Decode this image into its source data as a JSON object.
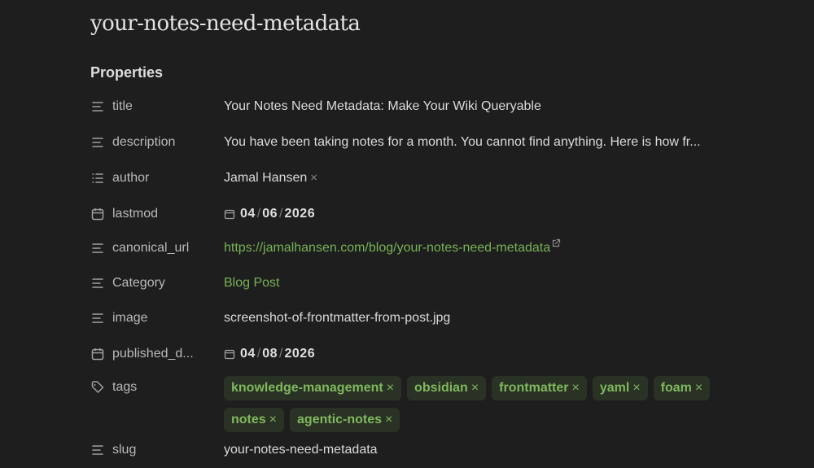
{
  "page": {
    "title": "your-notes-need-metadata",
    "properties_heading": "Properties"
  },
  "properties": {
    "title": {
      "key": "title",
      "icon": "text-lines-icon",
      "value": "Your Notes Need Metadata: Make Your Wiki Queryable"
    },
    "description": {
      "key": "description",
      "icon": "text-lines-icon",
      "value": "You have been taking notes for a month. You cannot find anything. Here is how fr..."
    },
    "author": {
      "key": "author",
      "icon": "list-icon",
      "value": "Jamal Hansen",
      "remove": "×"
    },
    "lastmod": {
      "key": "lastmod",
      "icon": "calendar-icon",
      "month": "04",
      "day": "06",
      "year": "2026",
      "sep": "/"
    },
    "canonical_url": {
      "key": "canonical_url",
      "icon": "text-lines-icon",
      "value": "https://jamalhansen.com/blog/your-notes-need-metadata"
    },
    "category": {
      "key": "Category",
      "icon": "text-lines-icon",
      "value": "Blog Post"
    },
    "image": {
      "key": "image",
      "icon": "text-lines-icon",
      "value": "screenshot-of-frontmatter-from-post.jpg"
    },
    "published_date": {
      "key": "published_d...",
      "icon": "calendar-icon",
      "month": "04",
      "day": "08",
      "year": "2026",
      "sep": "/"
    },
    "tags": {
      "key": "tags",
      "icon": "tag-icon",
      "remove": "×",
      "items": [
        "knowledge-management",
        "obsidian",
        "frontmatter",
        "yaml",
        "foam",
        "notes",
        "agentic-notes"
      ]
    },
    "slug": {
      "key": "slug",
      "icon": "text-lines-icon",
      "value": "your-notes-need-metadata"
    }
  },
  "colors": {
    "background": "#1e1e1e",
    "link": "#77b255",
    "tag_bg": "#2a3125",
    "tag_text": "#7fb85d"
  }
}
